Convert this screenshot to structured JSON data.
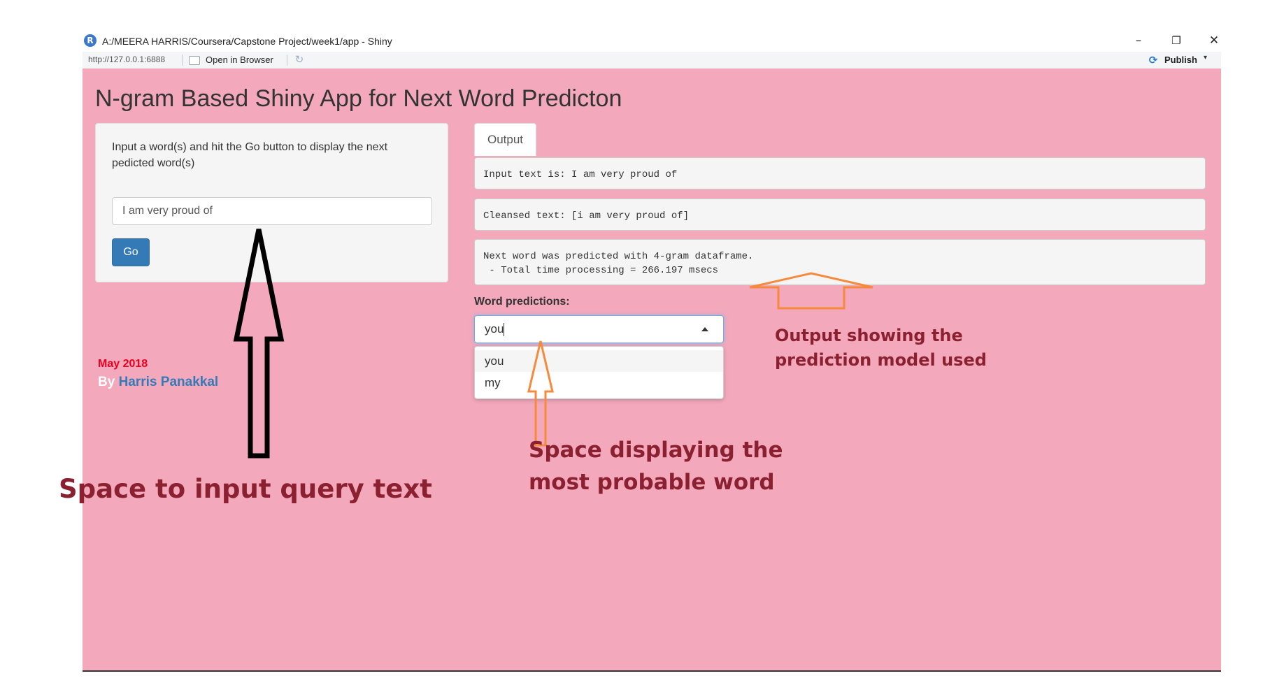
{
  "window": {
    "title": "A:/MEERA HARRIS/Coursera/Capstone Project/week1/app - Shiny",
    "app_icon_glyph": "R",
    "minimize_glyph": "–",
    "restore_glyph": "❐",
    "close_glyph": "✕"
  },
  "toolbar": {
    "url": "http://127.0.0.1:6888",
    "open_in_browser": "Open in Browser",
    "publish": "Publish",
    "refresh_glyph": "↻",
    "publish_glyph": "⟳",
    "publish_caret": "▾"
  },
  "app": {
    "title": "N-gram Based Shiny App for Next Word Predicton",
    "background_color": "#f3a8bc"
  },
  "sidebar": {
    "instruction": "Input a word(s) and hit the Go button to display the next pedicted word(s)",
    "input_value": "I am very proud of",
    "go_label": "Go",
    "footer_date": "May 2018",
    "footer_by": "By",
    "footer_author": "Harris Panakkal"
  },
  "main": {
    "tab_label": "Output",
    "input_text_line": "Input text is: I am very proud of",
    "cleansed_text_line": "Cleansed text: [i am very proud of]",
    "model_line_1": "Next word was predicted with 4-gram dataframe.",
    "model_line_2": " - Total time processing = 266.197 msecs",
    "predictions_label": "Word predictions:",
    "selected_value": "you",
    "options": [
      "you",
      "my"
    ]
  },
  "annotations": {
    "output_line1": "Output showing the",
    "output_line2": "prediction model used",
    "probable_line1": "Space displaying the",
    "probable_line2": "most probable word",
    "input_caption": "Space to input query text",
    "text_color": "#8b2130",
    "arrow_black": "#000000",
    "arrow_orange": "#f58a3c"
  }
}
